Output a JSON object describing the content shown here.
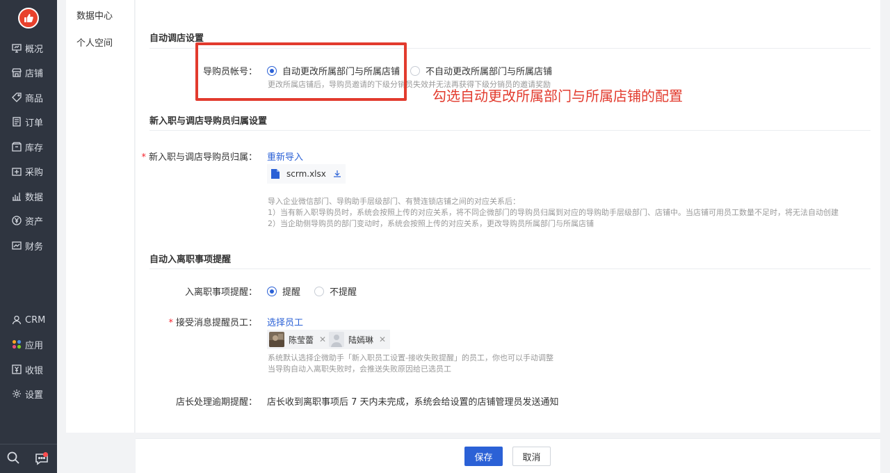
{
  "nav": {
    "items": [
      {
        "label": "概况",
        "icon": "monitor-icon"
      },
      {
        "label": "店铺",
        "icon": "store-icon"
      },
      {
        "label": "商品",
        "icon": "tag-icon"
      },
      {
        "label": "订单",
        "icon": "order-icon"
      },
      {
        "label": "库存",
        "icon": "inventory-icon"
      },
      {
        "label": "采购",
        "icon": "purchase-icon"
      },
      {
        "label": "数据",
        "icon": "chart-icon"
      },
      {
        "label": "资产",
        "icon": "yen-icon"
      },
      {
        "label": "财务",
        "icon": "finance-icon"
      }
    ],
    "bottom_items": [
      {
        "label": "CRM",
        "icon": "user-icon"
      },
      {
        "label": "应用",
        "icon": "apps-icon"
      },
      {
        "label": "收银",
        "icon": "cashier-icon"
      },
      {
        "label": "设置",
        "icon": "gear-icon"
      }
    ]
  },
  "submenu": {
    "items": [
      "数据中心",
      "个人空间"
    ]
  },
  "auto_transfer": {
    "title": "自动调店设置",
    "label": "导购员帐号：",
    "option_on": "自动更改所属部门与所属店铺",
    "option_off": "不自动更改所属部门与所属店铺",
    "hint": "更改所属店铺后，导购员邀请的下级分销员失效并无法再获得下级分销员的邀请奖励"
  },
  "annotation": {
    "text": "勾选自动更改所属部门与所属店铺的配置"
  },
  "attribution": {
    "title": "新入职与调店导购员归属设置",
    "label": "新入职与调店导购员归属：",
    "reimport": "重新导入",
    "file_name": "scrm.xlsx",
    "hint1": "导入企业微信部门、导购助手层级部门、有赞连锁店铺之间的对应关系后：",
    "hint2": "1）当有新入职导购员时，系统会按照上传的对应关系，将不同企微部门的导购员归属到对应的导购助手层级部门、店铺中。当店铺可用员工数量不足时，将无法自动创建",
    "hint3": "2）当企助侧导购员的部门变动时，系统会按照上传的对应关系，更改导购员所属部门与所属店铺"
  },
  "reminder": {
    "title": "自动入离职事项提醒",
    "label": "入离职事项提醒：",
    "option_on": "提醒",
    "option_off": "不提醒",
    "receiver_label": "接受消息提醒员工：",
    "select_link": "选择员工",
    "staff": [
      "陈莹蕾",
      "陆嫣琳"
    ],
    "hint1": "系统默认选择企微助手「新入职员工设置-接收失败提醒」的员工，你也可以手动调整",
    "hint2": "当导购自动入离职失败时，会推送失败原因给已选员工",
    "overdue_label": "店长处理逾期提醒：",
    "overdue_text": "店长收到离职事项后 7 天内未完成，系统会给设置的店铺管理员发送通知"
  },
  "footer": {
    "save": "保存",
    "cancel": "取消"
  }
}
